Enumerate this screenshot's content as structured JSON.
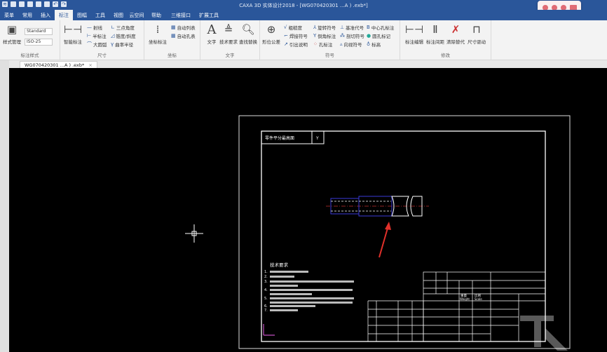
{
  "window": {
    "title": "CAXA 3D 实体设计2018 - [WG070420301 ...A ) .exb*]"
  },
  "tabs": [
    "菜单",
    "常用",
    "插入",
    "标注",
    "图幅",
    "工具",
    "视图",
    "云空间",
    "帮助",
    "三维接口",
    "扩展工具"
  ],
  "active_tab": "标注",
  "ribbon": {
    "style": {
      "label": "标注样式",
      "manage": "样式管理",
      "combo1": "Standard",
      "combo2": "ISO-25"
    },
    "dim": {
      "label": "尺寸",
      "smart": "智能标注",
      "items": [
        "射线",
        "半标注",
        "大圆弧",
        "三点角度",
        "锥度/斜度",
        "曲率半径"
      ]
    },
    "coord": {
      "label": "坐标",
      "coord_dim": "坐标标注",
      "items": [
        "自动列表",
        "自动孔表"
      ]
    },
    "text": {
      "label": "文字",
      "items": [
        "文字",
        "技术要求",
        "查找替换"
      ]
    },
    "symbol": {
      "label": "符号",
      "tol": "形位公差",
      "items": [
        "粗糙度",
        "焊接符号",
        "引出说明",
        "旋转符号",
        "倒角标注",
        "孔标注",
        "基准代号",
        "剖切符号",
        "向视符号",
        "中心孔标注",
        "圆孔标记",
        "标高"
      ]
    },
    "modify": {
      "label": "修改",
      "items": [
        "标注编辑",
        "标注间距",
        "清除替代",
        "尺寸驱动"
      ]
    }
  },
  "document_tab": {
    "name": "WG070420301 ...A ) .exb*",
    "close": "×"
  },
  "drawing": {
    "title_box": "零件平分最高面",
    "title_box_flag": "Y",
    "tech_req_title": "技术要求",
    "tech_req_numbers": [
      "1.",
      "2.",
      "3.",
      "4.",
      "5.",
      "6.",
      "7."
    ],
    "title_block": {
      "weight": "重量",
      "weight_en": "Weight",
      "scale": "比例",
      "scale_en": "Scale"
    },
    "colors": {
      "frame": "#ffffff",
      "part": "#3a3ad8",
      "center": "#c03030",
      "arrow": "#e0302a"
    }
  }
}
